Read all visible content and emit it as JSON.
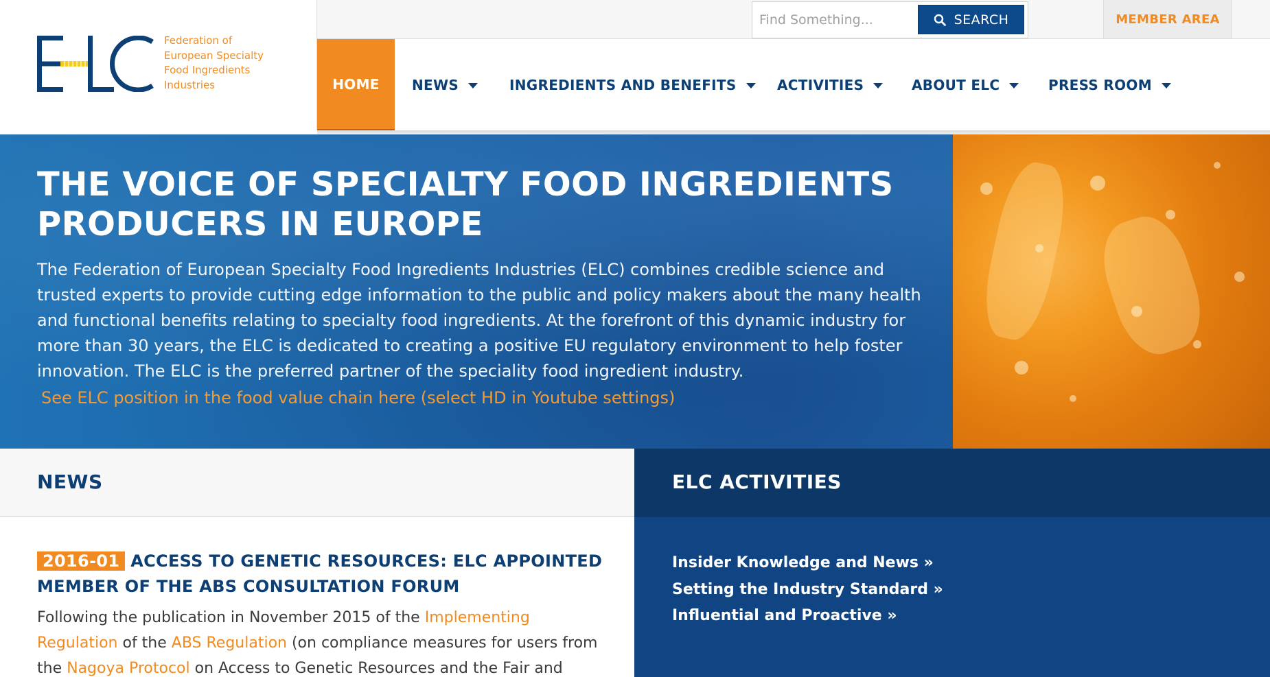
{
  "brand": {
    "logo_letters": "ELC",
    "logo_lines": [
      "Federation of",
      "European Specialty",
      "Food Ingredients",
      "Industries"
    ],
    "primary_color": "#0d3f74",
    "accent_color": "#f18b21"
  },
  "search": {
    "placeholder": "Find Something...",
    "button_label": "SEARCH",
    "icon": "search-icon"
  },
  "member_area_label": "MEMBER AREA",
  "nav": {
    "items": [
      {
        "label": "HOME",
        "active": true,
        "dropdown": false
      },
      {
        "label": "NEWS",
        "active": false,
        "dropdown": true
      },
      {
        "label": "INGREDIENTS AND BENEFITS",
        "active": false,
        "dropdown": true
      },
      {
        "label": "ACTIVITIES",
        "active": false,
        "dropdown": true
      },
      {
        "label": "ABOUT ELC",
        "active": false,
        "dropdown": true
      },
      {
        "label": "PRESS ROOM",
        "active": false,
        "dropdown": true
      }
    ]
  },
  "hero": {
    "title": "THE VOICE OF SPECIALTY FOOD INGREDIENTS PRODUCERS IN EUROPE",
    "description": "The Federation of European Specialty Food Ingredients Industries (ELC) combines credible science and trusted experts to provide cutting edge information to the public and policy makers about the many health and functional benefits relating to specialty food ingredients.  At the forefront of this dynamic industry for more than 30 years, the ELC is dedicated to creating a positive EU regulatory environment to help foster innovation. The ELC is the preferred partner of the speciality food ingredient industry.",
    "link": "See ELC position in the food value chain here (select HD in Youtube settings)"
  },
  "news": {
    "heading": "NEWS",
    "item": {
      "date": "2016-01",
      "headline": "ACCESS TO GENETIC RESOURCES: ELC APPOINTED MEMBER OF THE ABS CONSULTATION FORUM",
      "body_1": "Following the publication in November 2015 of the ",
      "link_1": "Implementing Regulation",
      "body_2": " of the ",
      "link_2": "ABS Regulation",
      "body_3": " (on compliance measures for users from the ",
      "link_3": "Nagoya Protocol",
      "body_4": " on Access to Genetic Resources and the Fair and"
    }
  },
  "activities": {
    "heading": "ELC ACTIVITIES",
    "links": [
      "Insider Knowledge and News »",
      "Setting the Industry Standard »",
      "Influential and Proactive »"
    ]
  }
}
